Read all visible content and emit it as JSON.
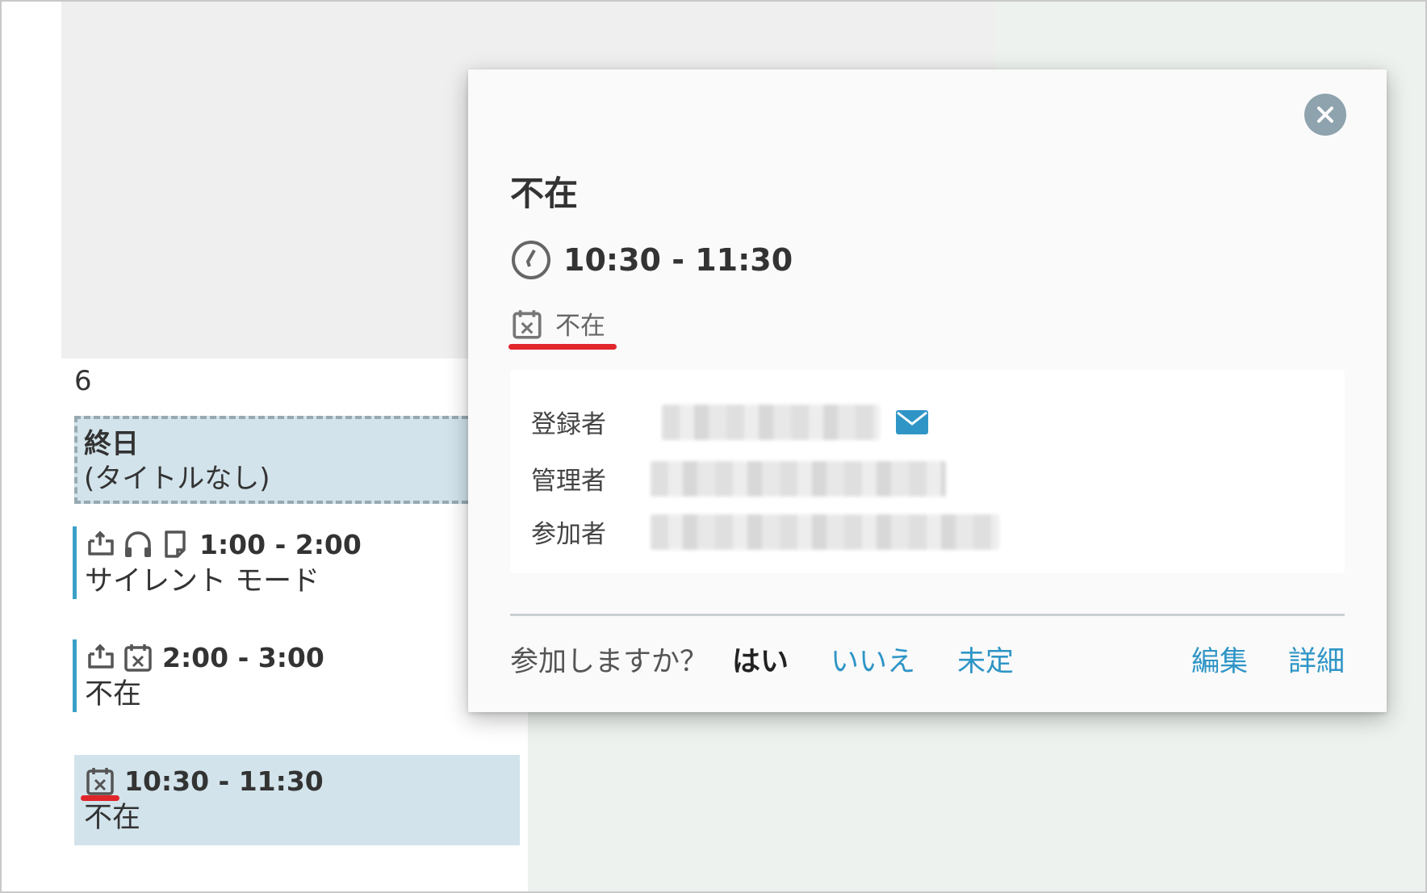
{
  "calendar": {
    "day_number": "6",
    "allday": {
      "label": "終日",
      "title": "(タイトルなし)"
    },
    "events": [
      {
        "time": "1:00 - 2:00",
        "title": "サイレント モード",
        "icons": [
          "repeat-icon",
          "headphones-icon",
          "note-icon"
        ]
      },
      {
        "time": "2:00 - 3:00",
        "title": "不在",
        "icons": [
          "repeat-icon",
          "calendar-x-icon"
        ]
      },
      {
        "time": "10:30 - 11:30",
        "title": "不在",
        "icons": [
          "calendar-x-icon"
        ],
        "selected": true
      }
    ]
  },
  "popup": {
    "title": "不在",
    "time": "10:30 - 11:30",
    "type_label": "不在",
    "people": [
      {
        "label": "登録者",
        "has_mail": true
      },
      {
        "label": "管理者",
        "has_mail": false
      },
      {
        "label": "参加者",
        "has_mail": false
      }
    ],
    "footer": {
      "question": "参加しますか？",
      "yes": "はい",
      "no": "いいえ",
      "maybe": "未定",
      "edit": "編集",
      "details": "詳細"
    }
  },
  "colors": {
    "accent": "#2f95c6",
    "event_bg": "#d2e3eb",
    "highlight": "#e0252b",
    "close_bg": "#8ea3ad"
  }
}
